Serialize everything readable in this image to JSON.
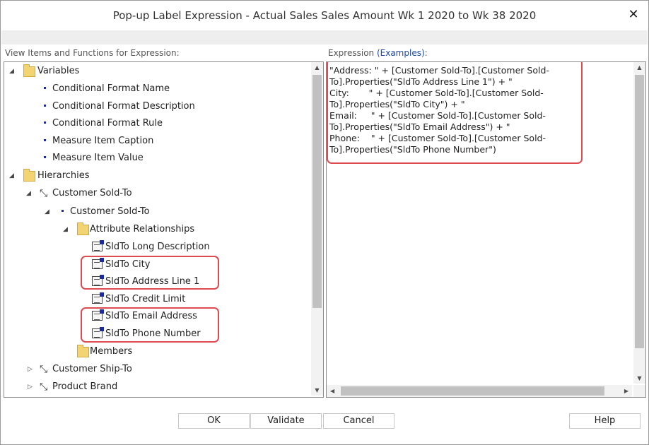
{
  "dialog": {
    "title": "Pop-up Label Expression - Actual Sales Sales Amount Wk 1 2020 to Wk 38 2020",
    "close_glyph": "✕"
  },
  "left_panel": {
    "label": "View Items and Functions for Expression:"
  },
  "right_panel": {
    "label_prefix": "Expression ",
    "examples_link": "(Examples)",
    "label_suffix": ":"
  },
  "tree": {
    "variables": "Variables",
    "var_items": [
      "Conditional Format Name",
      "Conditional Format Description",
      "Conditional Format Rule",
      "Measure Item Caption",
      "Measure Item Value"
    ],
    "hierarchies": "Hierarchies",
    "customer_sold_to": "Customer Sold-To",
    "customer_sold_to_level": "Customer Sold-To",
    "attribute_relationships": "Attribute Relationships",
    "attributes": [
      "SldTo Long Description",
      "SldTo City",
      "SldTo Address Line 1",
      "SldTo Credit Limit",
      "SldTo Email Address",
      "SldTo Phone Number"
    ],
    "members": "Members",
    "customer_ship_to": "Customer Ship-To",
    "product_brand": "Product Brand"
  },
  "expression": {
    "lines": [
      "\"Address: \" + [Customer Sold-To].[Customer Sold-",
      "To].Properties(\"SldTo Address Line 1\") + \"",
      "City:       \" + [Customer Sold-To].[Customer Sold-",
      "To].Properties(\"SldTo City\") + \"",
      "Email:     \" + [Customer Sold-To].[Customer Sold-",
      "To].Properties(\"SldTo Email Address\") + \"",
      "Phone:    \" + [Customer Sold-To].[Customer Sold-",
      "To].Properties(\"SldTo Phone Number\")"
    ]
  },
  "buttons": {
    "ok": "OK",
    "validate": "Validate",
    "cancel": "Cancel",
    "help": "Help"
  },
  "colors": {
    "highlight": "#de4a52",
    "link": "#1a47a8",
    "bullet": "#1a2aa5"
  }
}
